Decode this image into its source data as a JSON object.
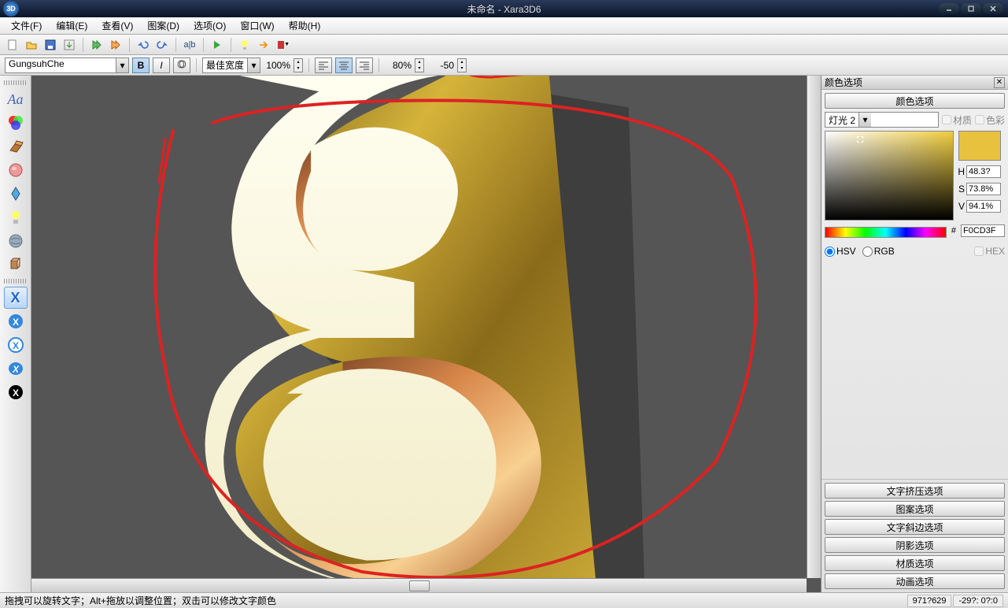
{
  "title": "未命名 - Xara3D6",
  "menu": [
    "文件(F)",
    "编辑(E)",
    "查看(V)",
    "图案(D)",
    "选项(O)",
    "窗口(W)",
    "帮助(H)"
  ],
  "font_name": "GungsuhChe",
  "width_mode": "最佳宽度",
  "zoom": "100%",
  "scale": "80%",
  "spacing": "-50",
  "panel": {
    "title": "颜色选项",
    "btn_main": "颜色选项",
    "light_sel": "灯光 2",
    "chk_material": "材质",
    "chk_color": "色彩",
    "hsv": {
      "h": "48.3?",
      "s": "73.8%",
      "v": "94.1%"
    },
    "hex": "F0CD3F",
    "mode_hsv": "HSV",
    "mode_rgb": "RGB",
    "mode_hex": "HEX",
    "swatch_color": "#e8c23e",
    "bottom_btns": [
      "文字挤压选项",
      "图案选项",
      "文字斜边选项",
      "阴影选项",
      "材质选项",
      "动画选项"
    ]
  },
  "status": {
    "hint": "拖拽可以旋转文字；Alt+拖放以调整位置；双击可以修改文字颜色",
    "coord": "971?629",
    "angle": "-29?: 0?:0"
  }
}
